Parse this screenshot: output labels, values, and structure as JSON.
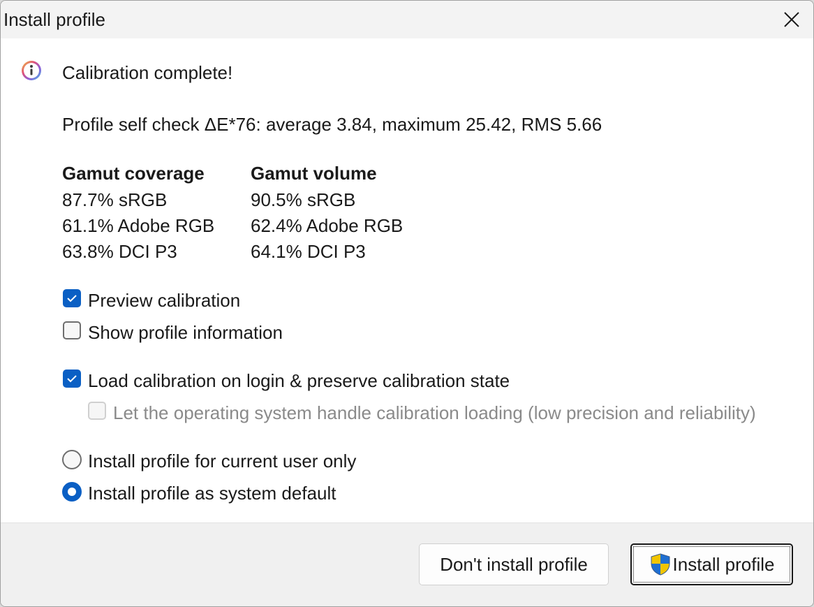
{
  "window": {
    "title": "Install profile",
    "close_icon": "close-icon"
  },
  "message": {
    "icon": "info-icon",
    "headline": "Calibration complete!",
    "self_check": "Profile self check ΔE*76: average 3.84, maximum 25.42, RMS 5.66"
  },
  "gamut": {
    "coverage": {
      "header": "Gamut coverage",
      "rows": [
        "87.7% sRGB",
        "61.1% Adobe RGB",
        "63.8% DCI P3"
      ]
    },
    "volume": {
      "header": "Gamut volume",
      "rows": [
        "90.5% sRGB",
        "62.4% Adobe RGB",
        "64.1% DCI P3"
      ]
    }
  },
  "options": {
    "preview_calibration": {
      "label": "Preview calibration",
      "checked": true
    },
    "show_profile_info": {
      "label": "Show profile information",
      "checked": false
    },
    "load_calibration": {
      "label": "Load calibration on login & preserve calibration state",
      "checked": true
    },
    "os_handle_loading": {
      "label": "Let the operating system handle calibration loading (low precision and reliability)",
      "checked": false,
      "disabled": true
    }
  },
  "install_scope": {
    "current_user": {
      "label": "Install profile for current user only",
      "selected": false
    },
    "system_default": {
      "label": "Install profile as system default",
      "selected": true
    }
  },
  "buttons": {
    "dont_install": "Don't install profile",
    "install": "Install profile",
    "install_icon": "uac-shield-icon"
  },
  "colors": {
    "accent": "#0a5fc4",
    "shield_blue": "#1f6fd1",
    "shield_yellow": "#f2c500"
  }
}
